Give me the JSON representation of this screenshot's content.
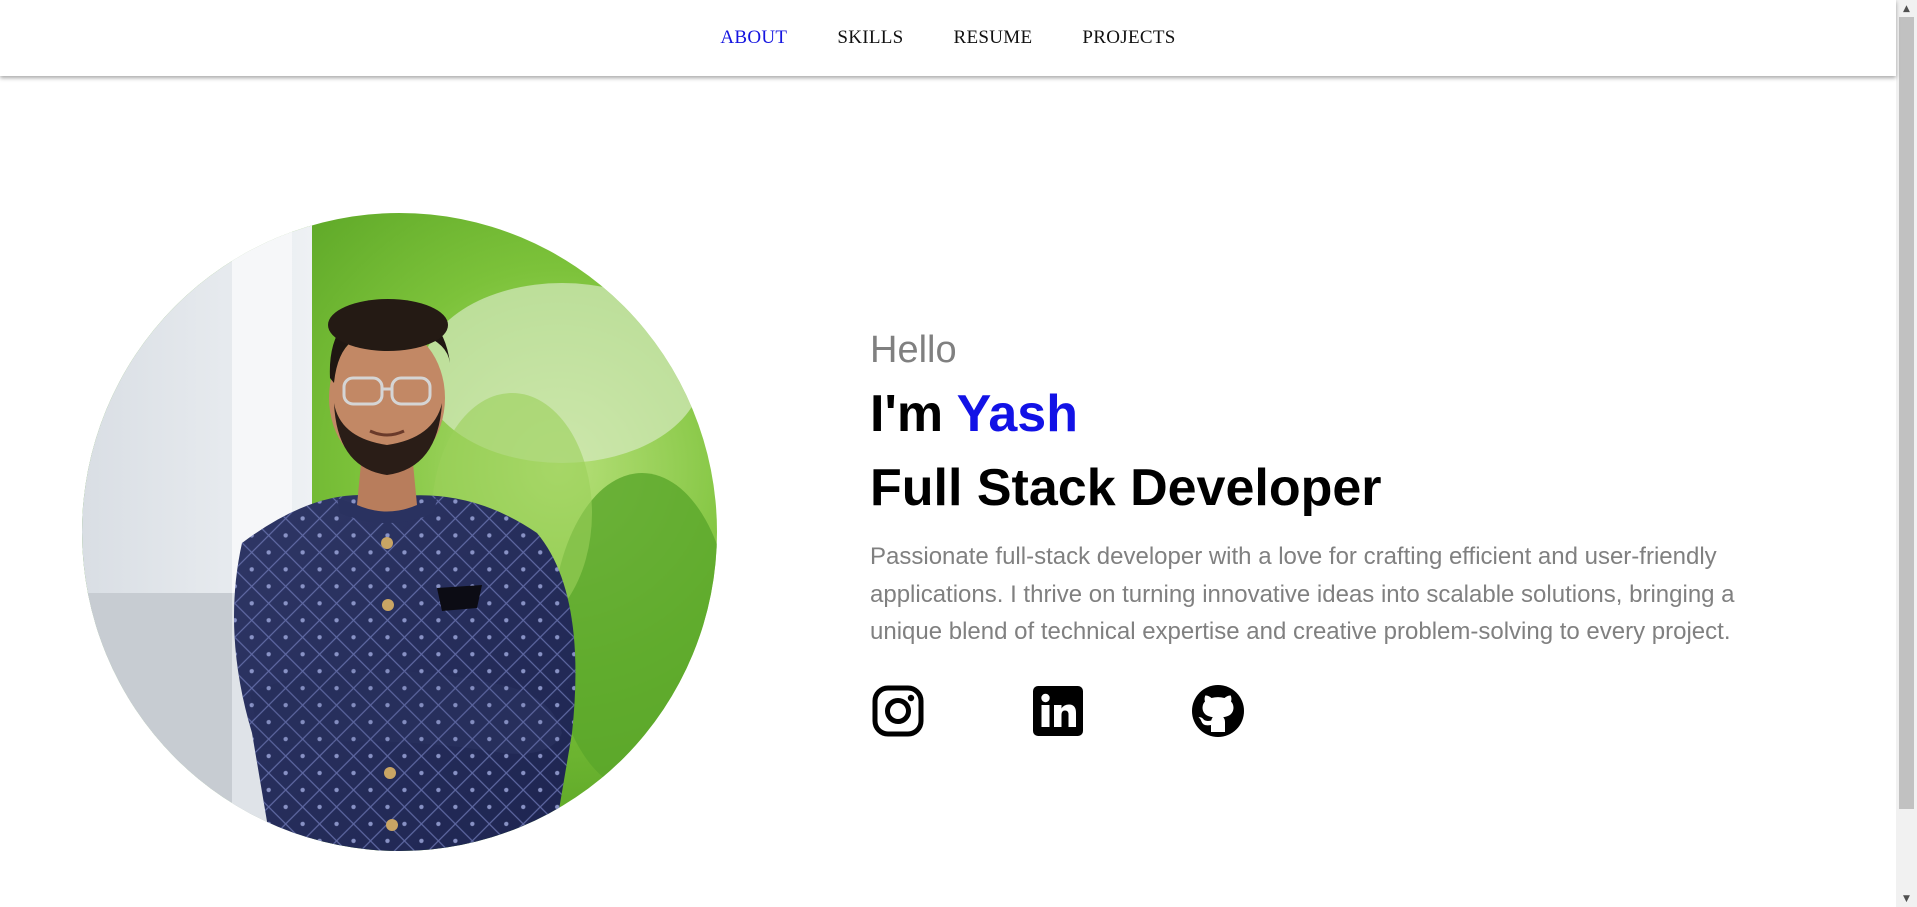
{
  "nav": {
    "items": [
      {
        "label": "ABOUT",
        "active": true
      },
      {
        "label": "SKILLS",
        "active": false
      },
      {
        "label": "RESUME",
        "active": false
      },
      {
        "label": "PROJECTS",
        "active": false
      }
    ]
  },
  "hero": {
    "greeting": "Hello",
    "intro_prefix": "I'm ",
    "name": "Yash",
    "role": "Full Stack Developer",
    "bio": "Passionate full-stack developer with a love for crafting efficient and user-friendly applications. I thrive on turning innovative ideas into scalable solutions, bringing a unique blend of technical expertise and creative problem-solving to every project.",
    "photo_alt": "portrait photo"
  },
  "socials": [
    {
      "icon": "instagram-icon"
    },
    {
      "icon": "linkedin-icon"
    },
    {
      "icon": "github-icon"
    }
  ],
  "colors": {
    "accent": "#1212e6",
    "muted": "#808080",
    "text": "#000000"
  }
}
